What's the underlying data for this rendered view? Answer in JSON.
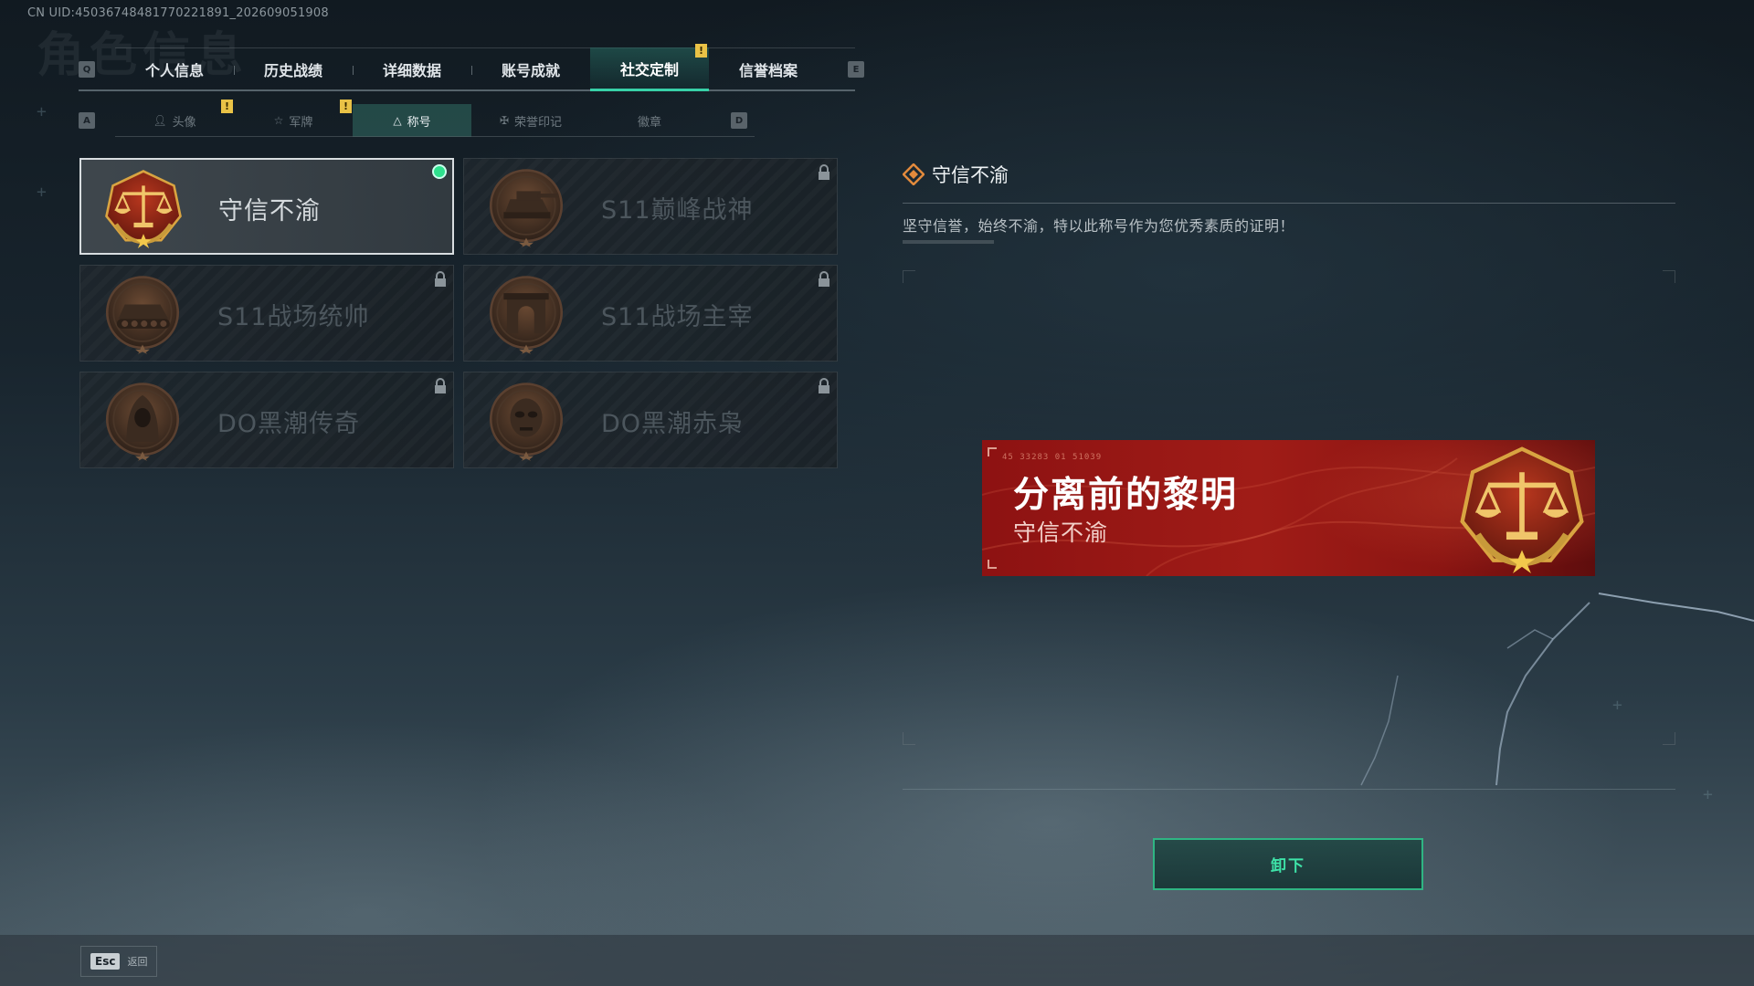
{
  "header": {
    "uid": "CN UID:450367484817702218​91_202609051908",
    "ghost_title": "角色信息"
  },
  "main_tabs": {
    "left_key": "Q",
    "right_key": "E",
    "items": [
      {
        "label": "个人信息"
      },
      {
        "label": "历史战绩"
      },
      {
        "label": "详细数据"
      },
      {
        "label": "账号成就"
      },
      {
        "label": "社交定制",
        "active": true,
        "alert": true
      },
      {
        "label": "信誉档案"
      }
    ]
  },
  "sub_tabs": {
    "left_key": "A",
    "right_key": "D",
    "items": [
      {
        "label": "头像",
        "icon": "person-icon",
        "alert": true
      },
      {
        "label": "军牌",
        "icon": "dogtag-icon",
        "alert": true
      },
      {
        "label": "称号",
        "icon": "triangle-icon",
        "active": true
      },
      {
        "label": "荣誉印记",
        "icon": "wings-icon"
      },
      {
        "label": "徽章",
        "icon": ""
      }
    ]
  },
  "titles": [
    {
      "name": "守信不渝",
      "emblem": "scales-emblem",
      "selected": true,
      "equipped": true,
      "locked": false
    },
    {
      "name": "S11巅峰战神",
      "emblem": "tank-turret-emblem",
      "locked": true
    },
    {
      "name": "S11战场统帅",
      "emblem": "apc-emblem",
      "locked": true
    },
    {
      "name": "S11战场主宰",
      "emblem": "arch-emblem",
      "locked": true
    },
    {
      "name": "DO黑潮传奇",
      "emblem": "hooded-figure-emblem",
      "locked": true
    },
    {
      "name": "DO黑潮赤枭",
      "emblem": "skull-mask-emblem",
      "locked": true
    }
  ],
  "detail": {
    "title": "守信不渝",
    "description": "坚守信誉，始终不渝，特以此称号作为您优秀素质的证明！"
  },
  "banner": {
    "code": "45 33283   01 51039",
    "title": "分离前的黎明",
    "subtitle": "守信不渝",
    "emblem": "scales-emblem"
  },
  "actions": {
    "unequip_label": "卸下"
  },
  "footer": {
    "esc_key": "Esc",
    "esc_label": "返回"
  },
  "colors": {
    "accent": "#38d1a8",
    "equipped_dot": "#2ee08d",
    "alert": "#e9c246",
    "banner_red": "#a01c17"
  }
}
